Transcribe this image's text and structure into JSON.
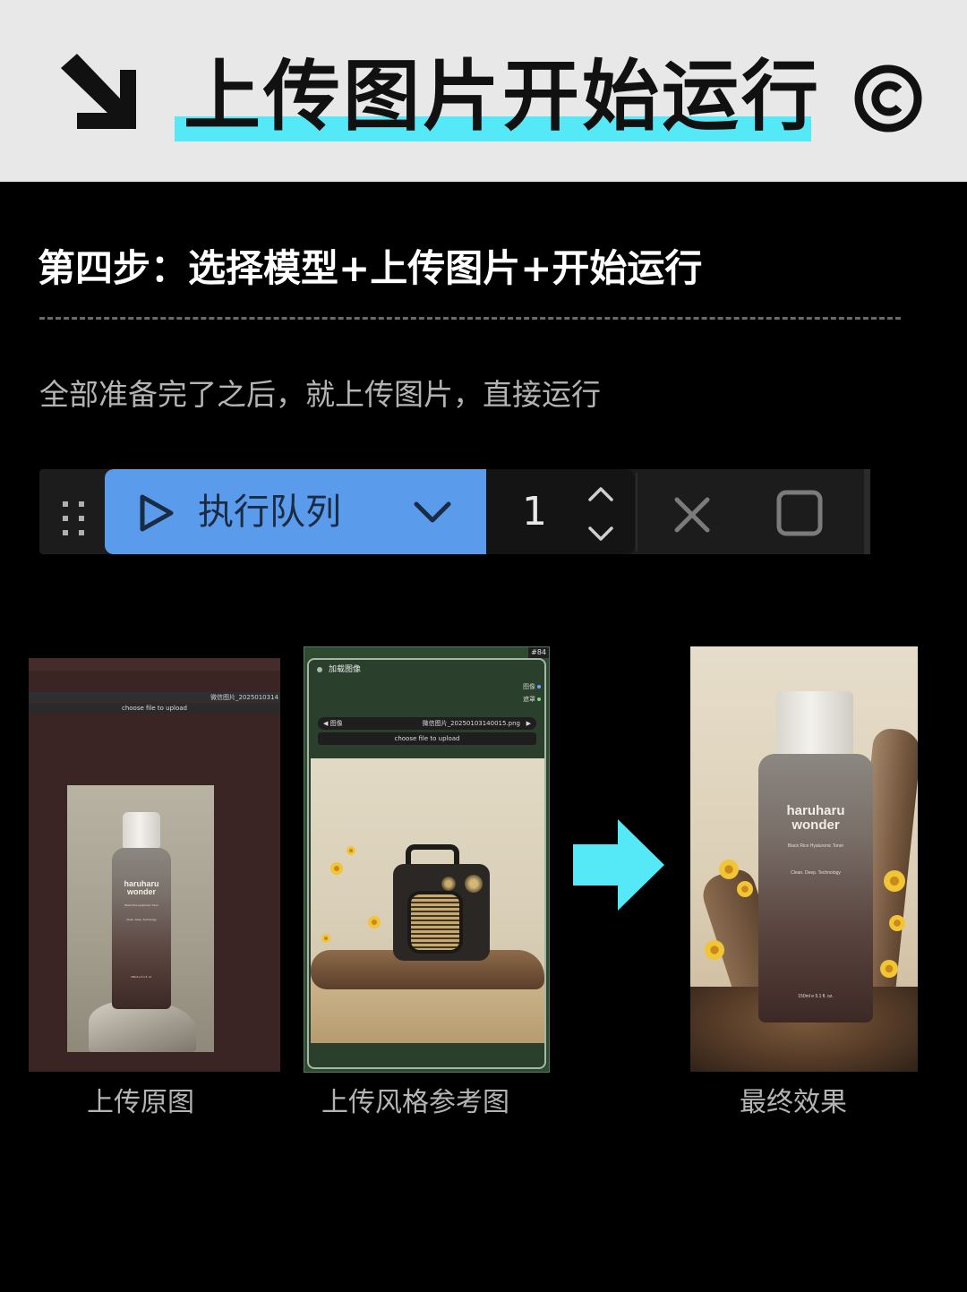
{
  "header": {
    "title": "上传图片开始运行",
    "highlight_color": "#55e8f7",
    "left_icon": "arrow-down-right-icon",
    "right_icon": "copyright-icon"
  },
  "step": {
    "title": "第四步：选择模型+上传图片+开始运行",
    "description": "全部准备完了之后，就上传图片，直接运行"
  },
  "toolbar": {
    "run_label": "执行队列",
    "batch_count": "1",
    "accent": "#5b9bec",
    "icons": [
      "drag-handle-icon",
      "play-icon",
      "chevron-down-icon",
      "chevron-up-icon",
      "close-icon",
      "stop-icon"
    ]
  },
  "image_original": {
    "filename": "微信图片_2025010314",
    "choose_label": "choose file to upload",
    "bottle_brand": "haruharu\nwonder",
    "bottle_sub": "Black Rice Hyaluronic Toner",
    "bottle_tag": "Clean. Deep. Technology",
    "bottle_volume": "150ml e 5.1 fl. oz."
  },
  "image_style": {
    "node_id": "#84",
    "node_title": "加载图像",
    "outputs": [
      "图像",
      "遮罩"
    ],
    "combo_label": "图像",
    "combo_value": "微信图片_20250103140015.png",
    "choose_label": "choose file to upload"
  },
  "image_final": {
    "bottle_brand": "haruharu\nwonder",
    "bottle_sub": "Black Rice Hyaluronic Toner",
    "bottle_tag": "Clean. Deep. Technology",
    "bottle_volume": "150ml e 5.1 fl. oz."
  },
  "captions": {
    "original": "上传原图",
    "style": "上传风格参考图",
    "final": "最终效果"
  },
  "arrow_color": "#55e8f7"
}
